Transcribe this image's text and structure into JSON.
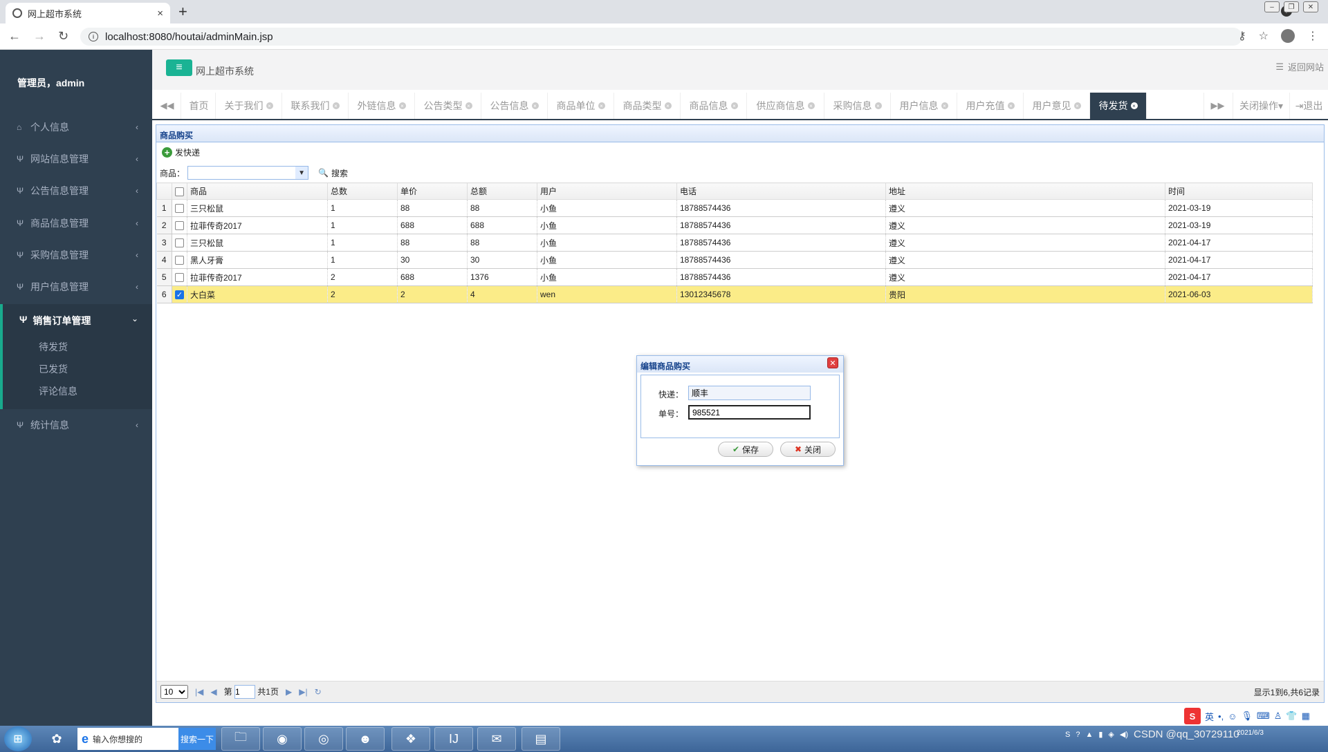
{
  "browser": {
    "tab_title": "网上超市系统",
    "tab_close": "×",
    "new_tab": "+",
    "url": "localhost:8080/houtai/adminMain.jsp"
  },
  "sidebar": {
    "user": "管理员，admin",
    "items": [
      {
        "label": "个人信息"
      },
      {
        "label": "网站信息管理"
      },
      {
        "label": "公告信息管理"
      },
      {
        "label": "商品信息管理"
      },
      {
        "label": "采购信息管理"
      },
      {
        "label": "用户信息管理"
      }
    ],
    "active": {
      "label": "销售订单管理",
      "children": [
        "待发货",
        "已发货",
        "评论信息"
      ]
    },
    "last": {
      "label": "统计信息"
    }
  },
  "header": {
    "title": "网上超市系统",
    "back_site": "返回网站"
  },
  "page_tabs": {
    "items": [
      "首页",
      "关于我们",
      "联系我们",
      "外链信息",
      "公告类型",
      "公告信息",
      "商品单位",
      "商品类型",
      "商品信息",
      "供应商信息",
      "采购信息",
      "用户信息",
      "用户充值",
      "用户意见",
      "待发货"
    ],
    "close_ops": "关闭操作",
    "logout": "退出"
  },
  "panel": {
    "title": "商品购买",
    "toolbar": {
      "ship_label": "发快递"
    },
    "search": {
      "goods_label": "商品：",
      "goods_value": "",
      "search_label": "搜索"
    }
  },
  "grid": {
    "columns": [
      "商品",
      "总数",
      "单价",
      "总额",
      "用户",
      "电话",
      "地址",
      "时间"
    ],
    "rows": [
      {
        "n": "1",
        "goods": "三只松鼠",
        "qty": "1",
        "price": "88",
        "total": "88",
        "user": "小鱼",
        "phone": "18788574436",
        "addr": "遵义",
        "time": "2021-03-19",
        "checked": false
      },
      {
        "n": "2",
        "goods": "拉菲传奇2017",
        "qty": "1",
        "price": "688",
        "total": "688",
        "user": "小鱼",
        "phone": "18788574436",
        "addr": "遵义",
        "time": "2021-03-19",
        "checked": false
      },
      {
        "n": "3",
        "goods": "三只松鼠",
        "qty": "1",
        "price": "88",
        "total": "88",
        "user": "小鱼",
        "phone": "18788574436",
        "addr": "遵义",
        "time": "2021-04-17",
        "checked": false
      },
      {
        "n": "4",
        "goods": "黑人牙膏",
        "qty": "1",
        "price": "30",
        "total": "30",
        "user": "小鱼",
        "phone": "18788574436",
        "addr": "遵义",
        "time": "2021-04-17",
        "checked": false
      },
      {
        "n": "5",
        "goods": "拉菲传奇2017",
        "qty": "2",
        "price": "688",
        "total": "1376",
        "user": "小鱼",
        "phone": "18788574436",
        "addr": "遵义",
        "time": "2021-04-17",
        "checked": false
      },
      {
        "n": "6",
        "goods": "大白菜",
        "qty": "2",
        "price": "2",
        "total": "4",
        "user": "wen",
        "phone": "13012345678",
        "addr": "贵阳",
        "time": "2021-06-03",
        "checked": true
      }
    ]
  },
  "pager": {
    "page_size": "10",
    "page_prefix": "第",
    "page_value": "1",
    "page_total": "共1页",
    "info": "显示1到6,共6记录"
  },
  "dialog": {
    "title": "编辑商品购买",
    "courier_label": "快递：",
    "courier_value": "顺丰",
    "number_label": "单号：",
    "number_value": "985521",
    "save_label": "保存",
    "close_label": "关闭"
  },
  "taskbar": {
    "search_placeholder": "输入你想搜的",
    "search_button": "搜索一下",
    "ime_label": "英",
    "watermark": "CSDN @qq_30729110",
    "date": "2021/6/3"
  },
  "colors": {
    "sidebar_bg": "#2f4050",
    "accent": "#1ab394",
    "selected_row": "#fbec88"
  }
}
